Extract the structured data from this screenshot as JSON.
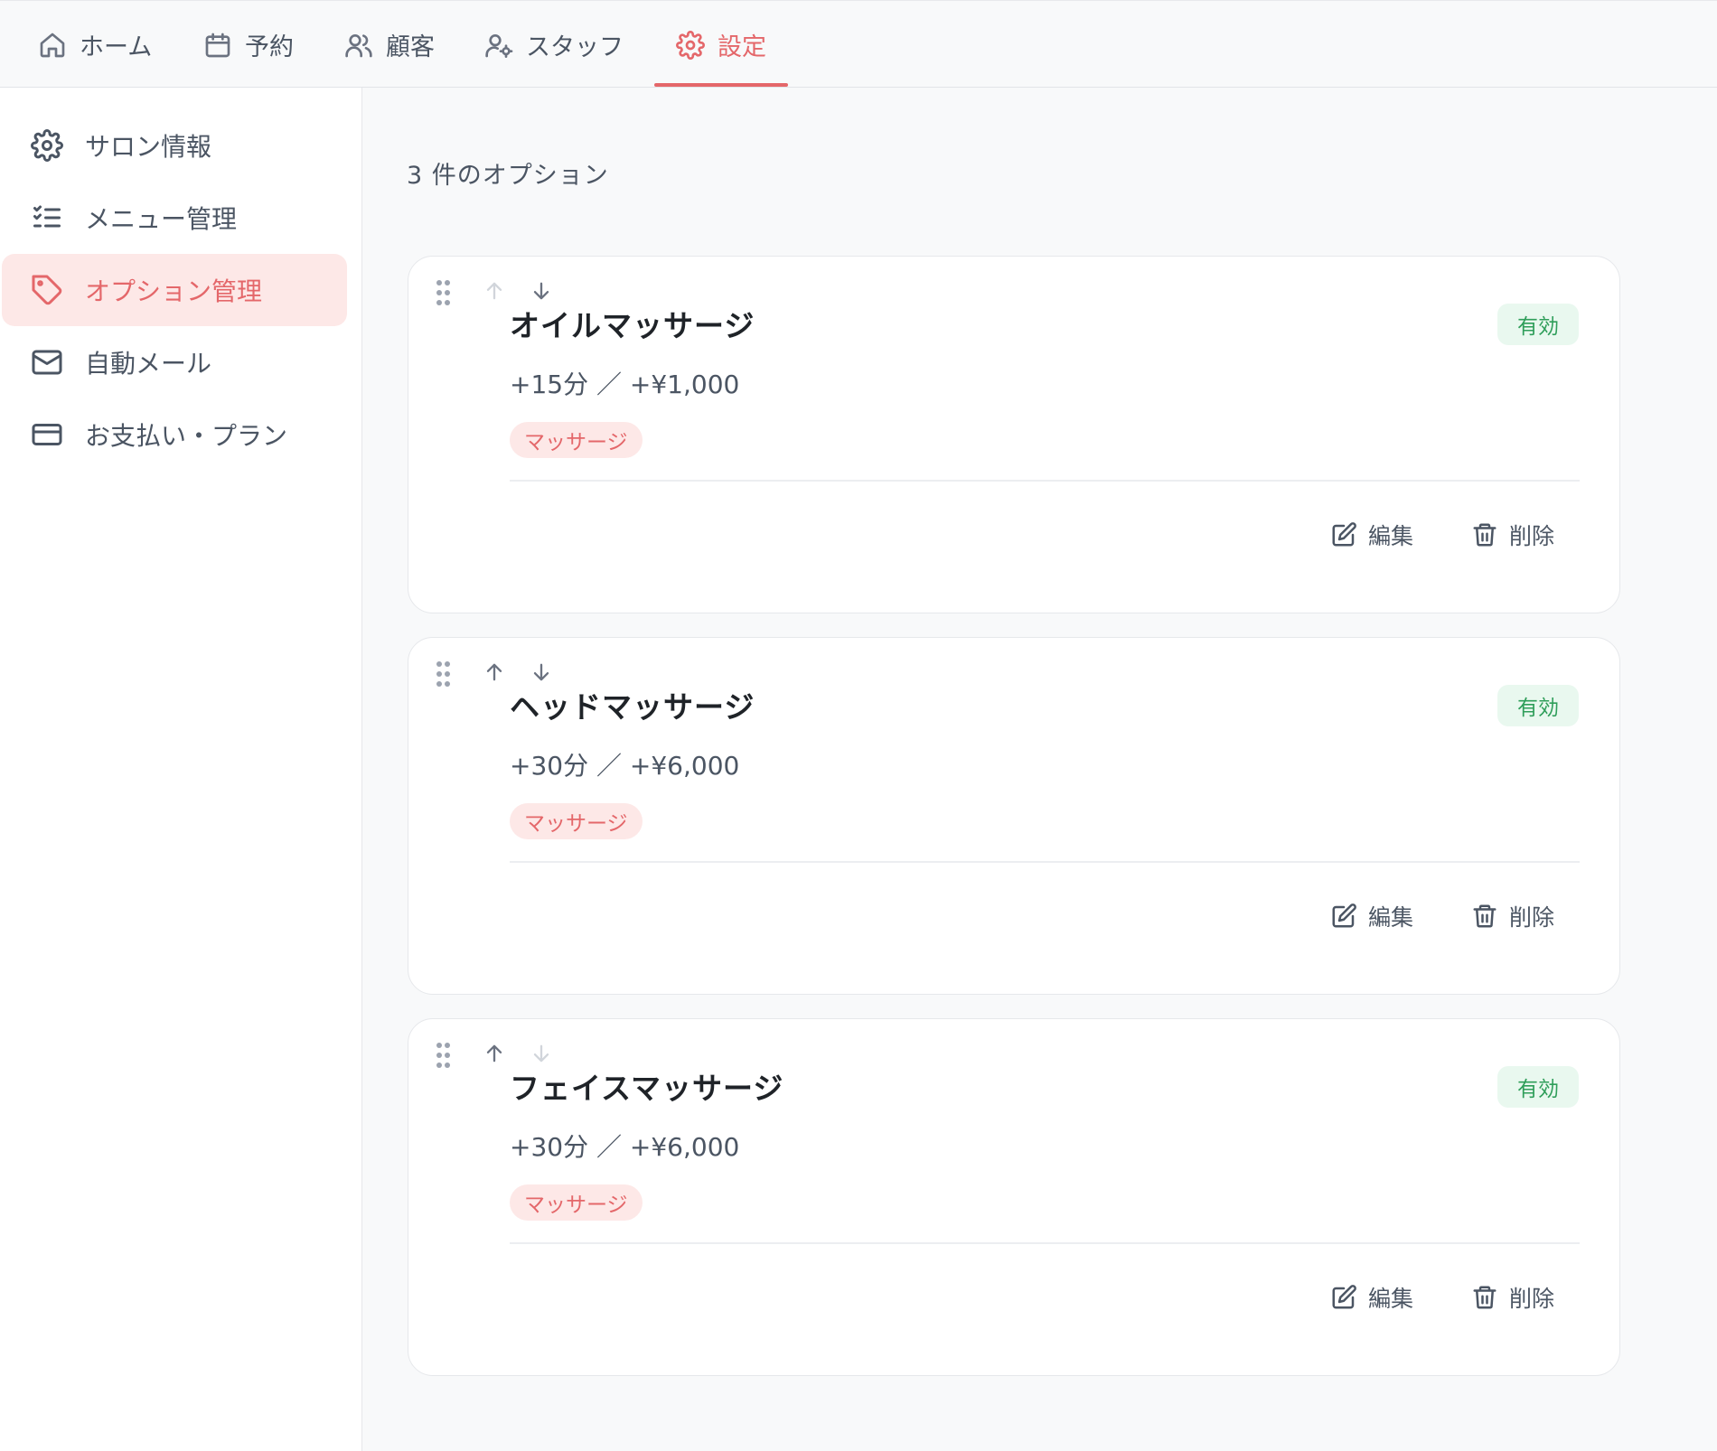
{
  "nav": {
    "tabs": [
      {
        "label": "ホーム",
        "icon": "home-icon"
      },
      {
        "label": "予約",
        "icon": "calendar-icon"
      },
      {
        "label": "顧客",
        "icon": "users-icon"
      },
      {
        "label": "スタッフ",
        "icon": "user-cog-icon"
      },
      {
        "label": "設定",
        "icon": "gear-icon",
        "active": true
      }
    ]
  },
  "sidebar": {
    "items": [
      {
        "label": "サロン情報",
        "icon": "gear-icon"
      },
      {
        "label": "メニュー管理",
        "icon": "list-checks-icon"
      },
      {
        "label": "オプション管理",
        "icon": "tag-icon",
        "active": true
      },
      {
        "label": "自動メール",
        "icon": "mail-icon"
      },
      {
        "label": "お支払い・プラン",
        "icon": "credit-card-icon"
      }
    ]
  },
  "main": {
    "count_label": "3 件のオプション",
    "options": [
      {
        "name": "オイルマッサージ",
        "meta": "+15分 ／ +¥1,000",
        "tag": "マッサージ",
        "status": "有効",
        "edit_label": "編集",
        "delete_label": "削除",
        "can_move_up": false,
        "can_move_down": true
      },
      {
        "name": "ヘッドマッサージ",
        "meta": "+30分 ／ +¥6,000",
        "tag": "マッサージ",
        "status": "有効",
        "edit_label": "編集",
        "delete_label": "削除",
        "can_move_up": true,
        "can_move_down": true
      },
      {
        "name": "フェイスマッサージ",
        "meta": "+30分 ／ +¥6,000",
        "tag": "マッサージ",
        "status": "有効",
        "edit_label": "編集",
        "delete_label": "削除",
        "can_move_up": true,
        "can_move_down": false
      }
    ]
  },
  "colors": {
    "accent": "#e4676a",
    "accent_bg": "#fde8e7",
    "status_text": "#2f9e5a",
    "status_bg": "#e9f8ef"
  }
}
